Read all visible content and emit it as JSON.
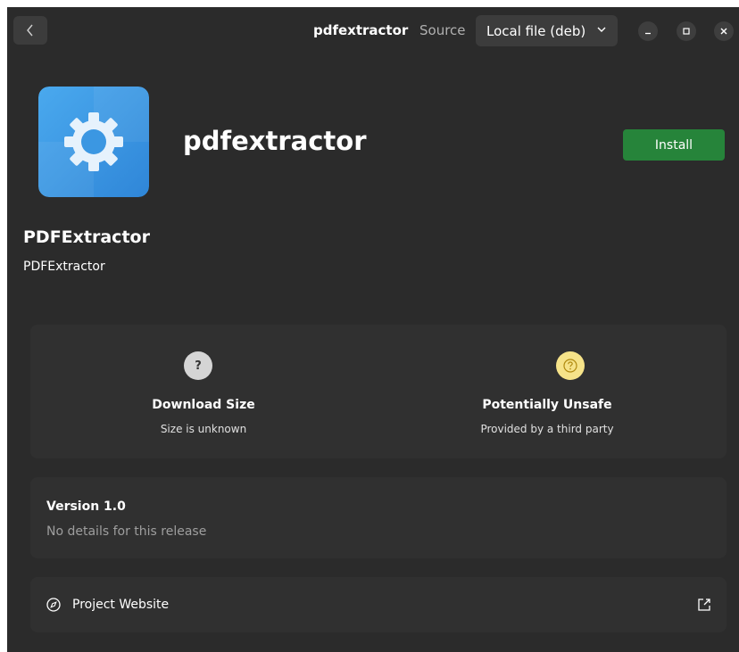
{
  "header": {
    "title": "pdfextractor",
    "source_label": "Source",
    "source_value": "Local file (deb)"
  },
  "app": {
    "name": "pdfextractor",
    "install_label": "Install",
    "summary_title": "PDFExtractor",
    "summary_subtitle": "PDFExtractor"
  },
  "context": {
    "size": {
      "icon": "question-mark-icon",
      "glyph": "?",
      "title": "Download Size",
      "description": "Size is unknown"
    },
    "safety": {
      "icon": "question-circle-icon",
      "title": "Potentially Unsafe",
      "description": "Provided by a third party"
    }
  },
  "version": {
    "title": "Version 1.0",
    "notes": "No details for this release"
  },
  "links": {
    "website_label": "Project Website"
  },
  "colors": {
    "accent_install": "#26843a",
    "window_bg": "#2b2b2b",
    "card_bg": "#303030",
    "unsafe_icon": "#f6e389"
  }
}
